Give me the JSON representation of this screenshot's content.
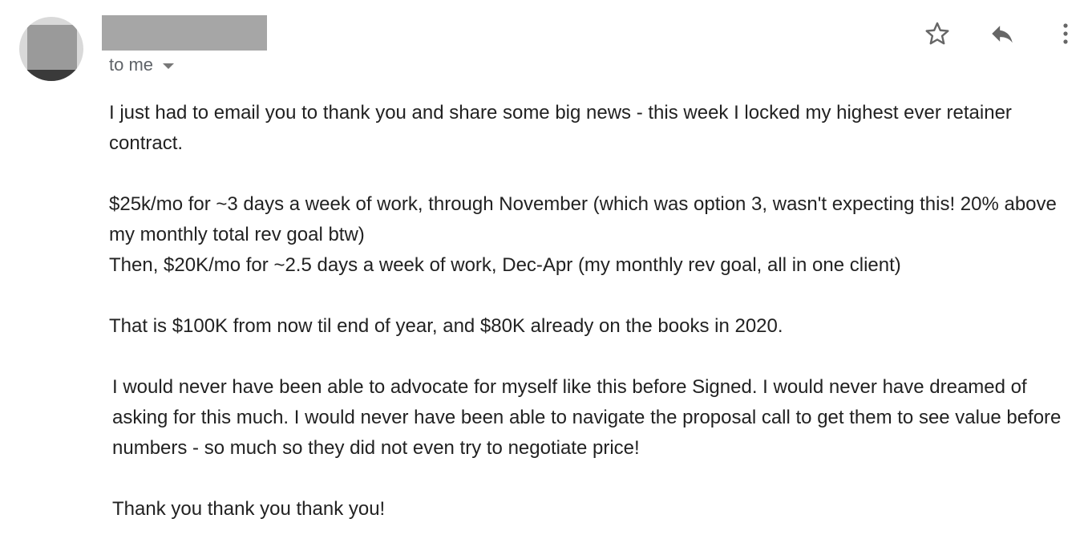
{
  "header": {
    "recipient_label": "to me"
  },
  "icons": {
    "star": "star-icon",
    "reply": "reply-icon",
    "more": "more-vertical-icon",
    "caret": "chevron-down-icon"
  },
  "message": {
    "p1": "I just had to email you to thank you and share some big news - this week I locked my highest ever retainer contract.",
    "p2_line1": "$25k/mo for ~3 days a week of work, through November (which was option 3, wasn't expecting this! 20% above my monthly total rev goal btw)",
    "p2_line2": "Then, $20K/mo for ~2.5 days a week of work, Dec-Apr (my monthly rev goal, all in one client)",
    "p3": "That is $100K from now til end of year, and $80K already on the books in 2020.",
    "p4": "I would never have been able to advocate for myself like this before Signed. I would never have dreamed of asking for this much. I would never have been able to navigate the proposal call to get them to see value before numbers - so much so they did not even try to negotiate price!",
    "p5": "Thank you thank you thank you!"
  }
}
